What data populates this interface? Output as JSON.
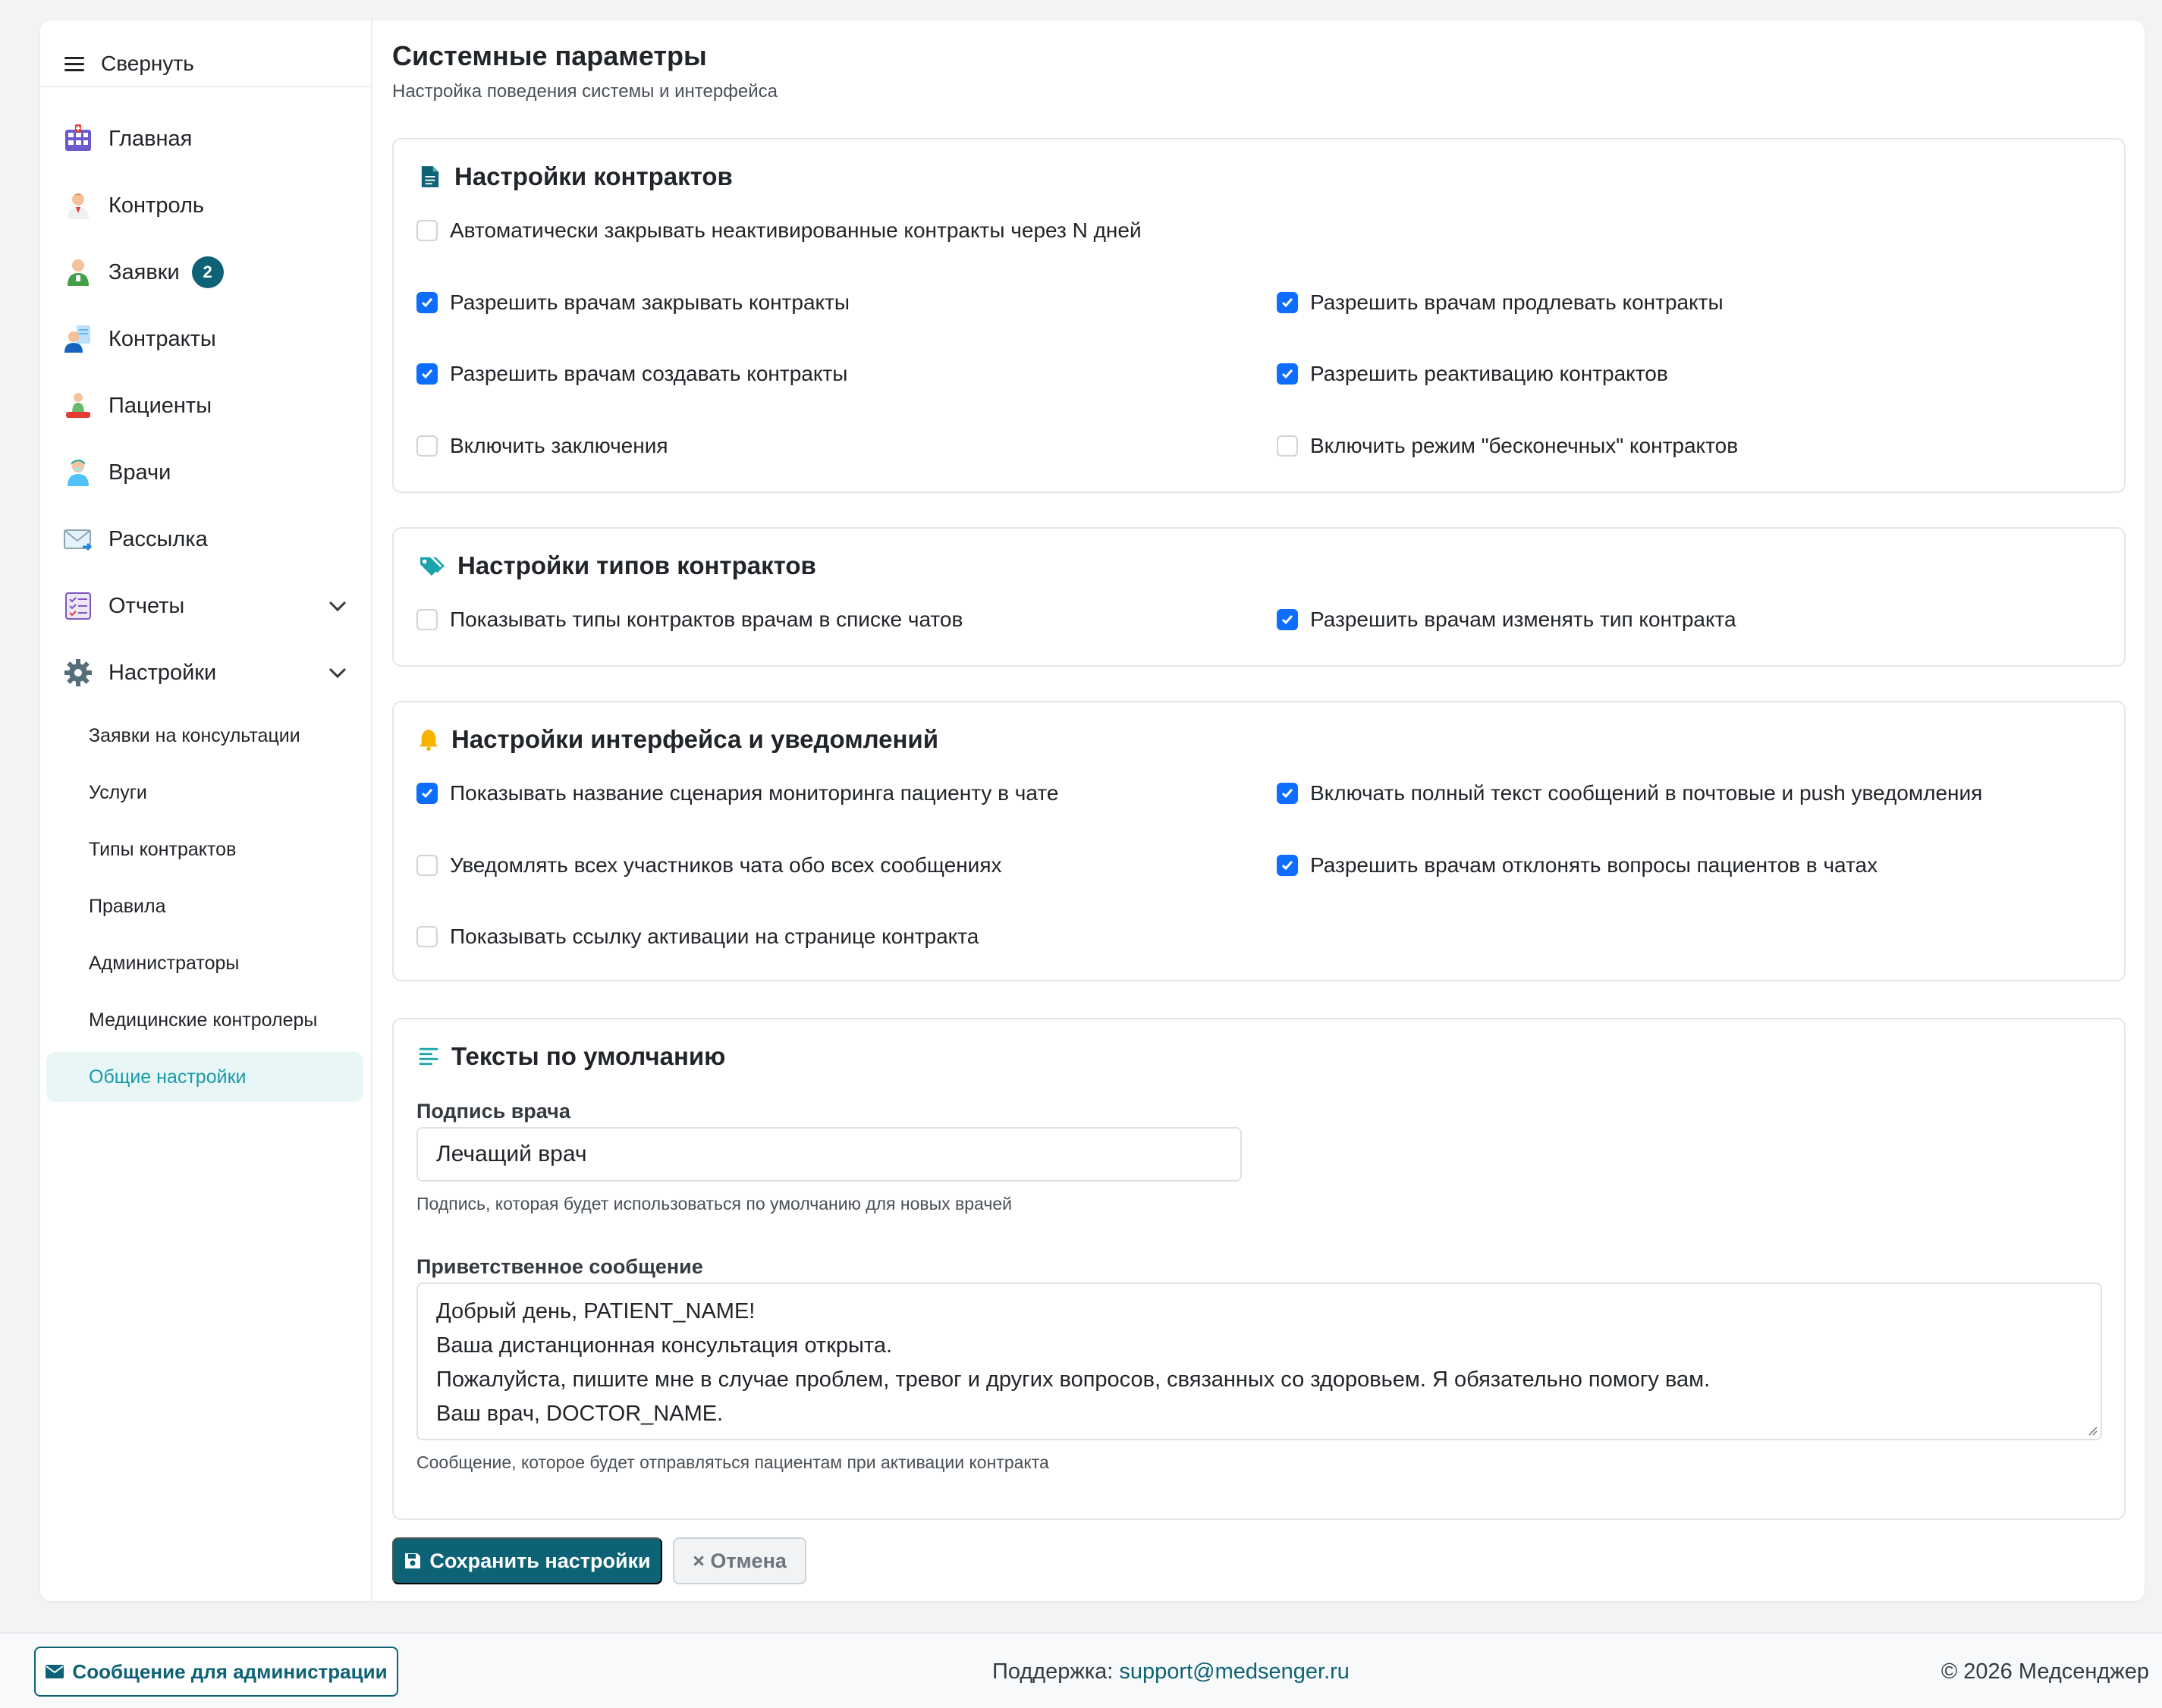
{
  "colors": {
    "accent": "#0d6275",
    "checkbox_checked": "#0d6efd",
    "active_sub_bg": "#e8f6f6",
    "active_sub_text": "#1a9aa8"
  },
  "sidebar": {
    "collapse_label": "Свернуть",
    "items": [
      {
        "label": "Главная",
        "icon": "dashboard-grid-icon"
      },
      {
        "label": "Контроль",
        "icon": "controller-person-icon"
      },
      {
        "label": "Заявки",
        "icon": "requests-person-icon",
        "badge": "2"
      },
      {
        "label": "Контракты",
        "icon": "contracts-person-icon"
      },
      {
        "label": "Пациенты",
        "icon": "patients-person-icon"
      },
      {
        "label": "Врачи",
        "icon": "doctors-person-icon"
      },
      {
        "label": "Рассылка",
        "icon": "mailing-envelope-icon"
      },
      {
        "label": "Отчеты",
        "icon": "reports-checklist-icon"
      },
      {
        "label": "Настройки",
        "icon": "gear-icon"
      }
    ],
    "settings_subitems": [
      {
        "label": "Заявки на консультации"
      },
      {
        "label": "Услуги"
      },
      {
        "label": "Типы контрактов"
      },
      {
        "label": "Правила"
      },
      {
        "label": "Администраторы"
      },
      {
        "label": "Медицинские контролеры"
      },
      {
        "label": "Общие настройки",
        "active": true
      }
    ]
  },
  "page": {
    "title": "Системные параметры",
    "subtitle": "Настройка поведения системы и интерфейса"
  },
  "contracts": {
    "title": "Настройки контрактов",
    "options": [
      {
        "label": "Автоматически закрывать неактивированные контракты через N дней",
        "checked": false
      },
      {
        "label": "Разрешить врачам закрывать контракты",
        "checked": true
      },
      {
        "label": "Разрешить врачам продлевать контракты",
        "checked": true
      },
      {
        "label": "Разрешить врачам создавать контракты",
        "checked": true
      },
      {
        "label": "Разрешить реактивацию контрактов",
        "checked": true
      },
      {
        "label": "Включить заключения",
        "checked": false
      },
      {
        "label": "Включить режим \"бесконечных\" контрактов",
        "checked": false
      }
    ]
  },
  "contract_types": {
    "title": "Настройки типов контрактов",
    "options": [
      {
        "label": "Показывать типы контрактов врачам в списке чатов",
        "checked": false
      },
      {
        "label": "Разрешить врачам изменять тип контракта",
        "checked": true
      }
    ]
  },
  "notifications": {
    "title": "Настройки интерфейса и уведомлений",
    "options": [
      {
        "label": "Показывать название сценария мониторинга пациенту в чате",
        "checked": true
      },
      {
        "label": "Включать полный текст сообщений в почтовые и push уведомления",
        "checked": true
      },
      {
        "label": "Уведомлять всех участников чата обо всех сообщениях",
        "checked": false
      },
      {
        "label": "Разрешить врачам отклонять вопросы пациентов в чатах",
        "checked": true
      },
      {
        "label": "Показывать ссылку активации на странице контракта",
        "checked": false
      }
    ]
  },
  "defaults": {
    "title": "Тексты по умолчанию",
    "signature_label": "Подпись врача",
    "signature_value": "Лечащий врач",
    "signature_hint": "Подпись, которая будет использоваться по умолчанию для новых врачей",
    "greeting_label": "Приветственное сообщение",
    "greeting_lines": [
      "Добрый день, PATIENT_NAME!",
      "Ваша дистанционная консультация открыта.",
      "Пожалуйста, пишите мне в случае проблем, тревог и других вопросов, связанных со здоровьем. Я обязательно помогу вам.",
      "Ваш врач, DOCTOR_NAME."
    ],
    "greeting_hint": "Сообщение, которое будет отправляться пациентам при активации контракта"
  },
  "actions": {
    "save_label": "Сохранить настройки",
    "cancel_label": "× Отмена"
  },
  "footer": {
    "admin_message_label": "Сообщение для администрации",
    "support_label": "Поддержка:",
    "support_email": "support@medsenger.ru",
    "copyright": "© 2026 Медсенджер"
  }
}
